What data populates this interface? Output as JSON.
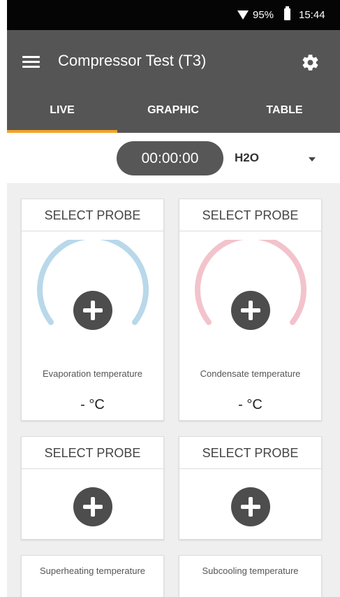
{
  "status_bar": {
    "battery_percent": "95%",
    "time": "15:44",
    "icons": [
      "wifi-icon",
      "battery-icon"
    ]
  },
  "app_bar": {
    "title": "Compressor Test (T3)",
    "menu_icon": "hamburger-menu-icon",
    "settings_icon": "gear-icon"
  },
  "tabs": [
    {
      "label": "LIVE",
      "active": true
    },
    {
      "label": "GRAPHIC",
      "active": false
    },
    {
      "label": "TABLE",
      "active": false
    }
  ],
  "controls": {
    "timer": "00:00:00",
    "medium": "H2O"
  },
  "tiles": [
    {
      "header": "SELECT PROBE",
      "label": "Evaporation temperature",
      "value": "- °C",
      "gauge_color": "#b9d8ea"
    },
    {
      "header": "SELECT PROBE",
      "label": "Condensate temperature",
      "value": "- °C",
      "gauge_color": "#f3c3cc"
    },
    {
      "header": "SELECT PROBE"
    },
    {
      "header": "SELECT PROBE"
    },
    {
      "label": "Superheating temperature"
    },
    {
      "label": "Subcooling temperature"
    }
  ],
  "colors": {
    "app_bar": "#555555",
    "tab_indicator": "#f2a425",
    "status_bar": "#050505"
  }
}
